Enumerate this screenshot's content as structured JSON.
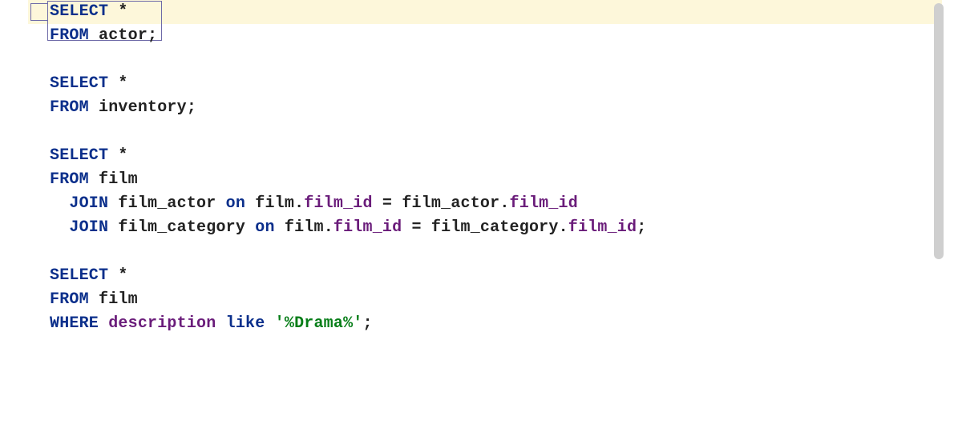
{
  "editor": {
    "highlighted_line_index": 0,
    "lines": [
      {
        "indent": 0,
        "tokens": [
          {
            "t": "SELECT",
            "c": "kw"
          },
          {
            "t": " ",
            "c": "txt"
          },
          {
            "t": "*",
            "c": "op"
          }
        ]
      },
      {
        "indent": 0,
        "tokens": [
          {
            "t": "FROM",
            "c": "kw"
          },
          {
            "t": " ",
            "c": "txt"
          },
          {
            "t": "actor",
            "c": "txt"
          },
          {
            "t": ";",
            "c": "semi"
          }
        ]
      },
      {
        "indent": 0,
        "tokens": []
      },
      {
        "indent": 0,
        "tokens": [
          {
            "t": "SELECT",
            "c": "kw"
          },
          {
            "t": " ",
            "c": "txt"
          },
          {
            "t": "*",
            "c": "op"
          }
        ]
      },
      {
        "indent": 0,
        "tokens": [
          {
            "t": "FROM",
            "c": "kw"
          },
          {
            "t": " ",
            "c": "txt"
          },
          {
            "t": "inventory",
            "c": "txt"
          },
          {
            "t": ";",
            "c": "semi"
          }
        ]
      },
      {
        "indent": 0,
        "tokens": []
      },
      {
        "indent": 0,
        "tokens": [
          {
            "t": "SELECT",
            "c": "kw"
          },
          {
            "t": " ",
            "c": "txt"
          },
          {
            "t": "*",
            "c": "op"
          }
        ]
      },
      {
        "indent": 0,
        "tokens": [
          {
            "t": "FROM",
            "c": "kw"
          },
          {
            "t": " ",
            "c": "txt"
          },
          {
            "t": "film",
            "c": "txt"
          }
        ]
      },
      {
        "indent": 1,
        "tokens": [
          {
            "t": "JOIN",
            "c": "kw"
          },
          {
            "t": " ",
            "c": "txt"
          },
          {
            "t": "film_actor",
            "c": "txt"
          },
          {
            "t": " ",
            "c": "txt"
          },
          {
            "t": "on",
            "c": "kw"
          },
          {
            "t": " ",
            "c": "txt"
          },
          {
            "t": "film",
            "c": "txt"
          },
          {
            "t": ".",
            "c": "op"
          },
          {
            "t": "film_id",
            "c": "id"
          },
          {
            "t": " = ",
            "c": "op"
          },
          {
            "t": "film_actor",
            "c": "txt"
          },
          {
            "t": ".",
            "c": "op"
          },
          {
            "t": "film_id",
            "c": "id"
          }
        ]
      },
      {
        "indent": 1,
        "tokens": [
          {
            "t": "JOIN",
            "c": "kw"
          },
          {
            "t": " ",
            "c": "txt"
          },
          {
            "t": "film_category",
            "c": "txt"
          },
          {
            "t": " ",
            "c": "txt"
          },
          {
            "t": "on",
            "c": "kw"
          },
          {
            "t": " ",
            "c": "txt"
          },
          {
            "t": "film",
            "c": "txt"
          },
          {
            "t": ".",
            "c": "op"
          },
          {
            "t": "film_id",
            "c": "id"
          },
          {
            "t": " = ",
            "c": "op"
          },
          {
            "t": "film_category",
            "c": "txt"
          },
          {
            "t": ".",
            "c": "op"
          },
          {
            "t": "film_id",
            "c": "id"
          },
          {
            "t": ";",
            "c": "semi"
          }
        ]
      },
      {
        "indent": 0,
        "tokens": []
      },
      {
        "indent": 0,
        "tokens": [
          {
            "t": "SELECT",
            "c": "kw"
          },
          {
            "t": " ",
            "c": "txt"
          },
          {
            "t": "*",
            "c": "op"
          }
        ]
      },
      {
        "indent": 0,
        "tokens": [
          {
            "t": "FROM",
            "c": "kw"
          },
          {
            "t": " ",
            "c": "txt"
          },
          {
            "t": "film",
            "c": "txt"
          }
        ]
      },
      {
        "indent": 0,
        "tokens": [
          {
            "t": "WHERE",
            "c": "kw"
          },
          {
            "t": " ",
            "c": "txt"
          },
          {
            "t": "description",
            "c": "id"
          },
          {
            "t": " ",
            "c": "txt"
          },
          {
            "t": "like",
            "c": "kw"
          },
          {
            "t": " ",
            "c": "txt"
          },
          {
            "t": "'%Drama%'",
            "c": "str"
          },
          {
            "t": ";",
            "c": "semi"
          }
        ]
      }
    ]
  }
}
